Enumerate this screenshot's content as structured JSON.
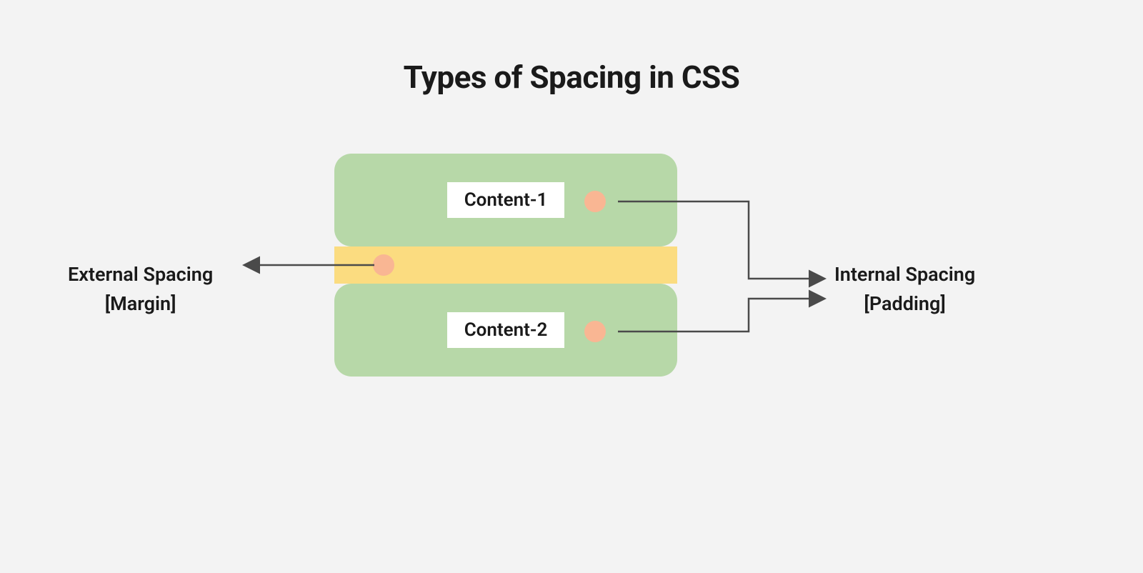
{
  "title": "Types of Spacing in CSS",
  "boxes": {
    "content1": "Content-1",
    "content2": "Content-2"
  },
  "labels": {
    "external_line1": "External Spacing",
    "external_line2": "[Margin]",
    "internal_line1": "Internal Spacing",
    "internal_line2": "[Padding]"
  },
  "colors": {
    "box": "#b7d8a8",
    "margin": "#fbdc80",
    "dot": "#f9b693",
    "arrow": "#4a4a4a",
    "background": "#f3f3f3"
  }
}
